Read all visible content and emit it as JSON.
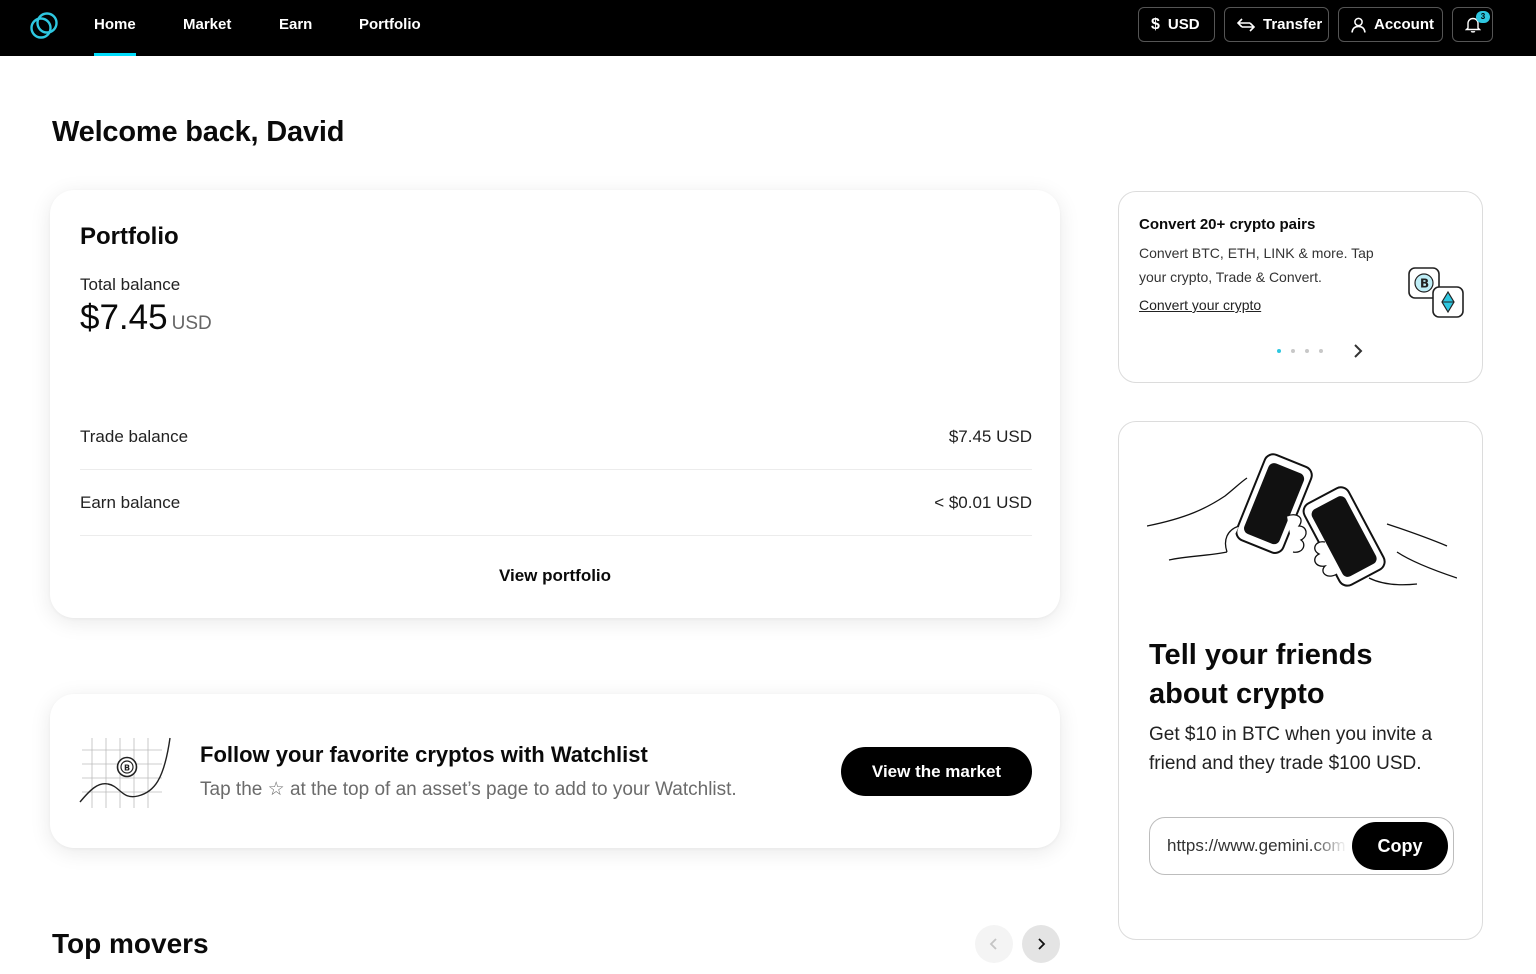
{
  "nav": {
    "links": [
      {
        "label": "Home",
        "active": true
      },
      {
        "label": "Market",
        "active": false
      },
      {
        "label": "Earn",
        "active": false
      },
      {
        "label": "Portfolio",
        "active": false
      }
    ],
    "currency_label": "USD",
    "transfer_label": "Transfer",
    "account_label": "Account",
    "notification_count": "3",
    "icons": {
      "logo": "gemini-logo-icon",
      "currency": "dollar-icon",
      "transfer": "transfer-arrows-icon",
      "account": "user-icon",
      "notifications": "bell-icon"
    }
  },
  "welcome": "Welcome back, David",
  "portfolio": {
    "title": "Portfolio",
    "total_label": "Total balance",
    "total_value": "$7.45",
    "total_unit": "USD",
    "rows": [
      {
        "label": "Trade balance",
        "value": "$7.45 USD"
      },
      {
        "label": "Earn balance",
        "value": "< $0.01 USD"
      }
    ],
    "view_label": "View portfolio"
  },
  "watchlist": {
    "title": "Follow your favorite cryptos with Watchlist",
    "subtitle_before": "Tap the",
    "subtitle_after": "at the top of an asset’s page to add to your Watchlist.",
    "star_icon": "star-icon",
    "button_label": "View the market"
  },
  "top_movers": {
    "title": "Top movers"
  },
  "convert_promo": {
    "title": "Convert 20+ crypto pairs",
    "text": "Convert BTC, ETH, LINK & more. Tap your crypto, Trade & Convert.",
    "link": "Convert your crypto",
    "slide_count": 4,
    "active_slide": 1
  },
  "referral": {
    "title": "Tell your friends about crypto",
    "text": "Get $10 in BTC when you invite a friend and they trade $100 USD.",
    "url": "https://www.gemini.com",
    "copy_label": "Copy"
  },
  "colors": {
    "accent": "#00dcfa",
    "nav_bg": "#000000",
    "badge": "#2ec7e0"
  }
}
